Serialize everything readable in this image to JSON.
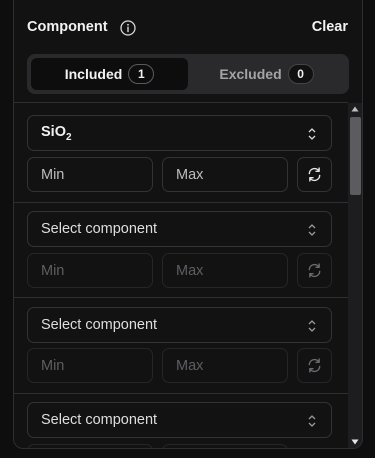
{
  "header": {
    "title": "Component",
    "clear_label": "Clear"
  },
  "tabs": [
    {
      "label": "Included",
      "count": "1"
    },
    {
      "label": "Excluded",
      "count": "0"
    }
  ],
  "rows": [
    {
      "component": "SiO",
      "component_sub": "2",
      "min_placeholder": "Min",
      "max_placeholder": "Max"
    },
    {
      "component": "Select component",
      "min_placeholder": "Min",
      "max_placeholder": "Max"
    },
    {
      "component": "Select component",
      "min_placeholder": "Min",
      "max_placeholder": "Max"
    },
    {
      "component": "Select component",
      "min_placeholder": "Min",
      "max_placeholder": "Max"
    }
  ],
  "icons": {
    "info": "info-circle-icon",
    "chevron": "chevron-up-down-icon",
    "refresh": "refresh-icon"
  },
  "colors": {
    "background": "#121213",
    "border": "#333336",
    "accent_text": "#f2f2f2",
    "muted_text": "#5e5e62"
  }
}
